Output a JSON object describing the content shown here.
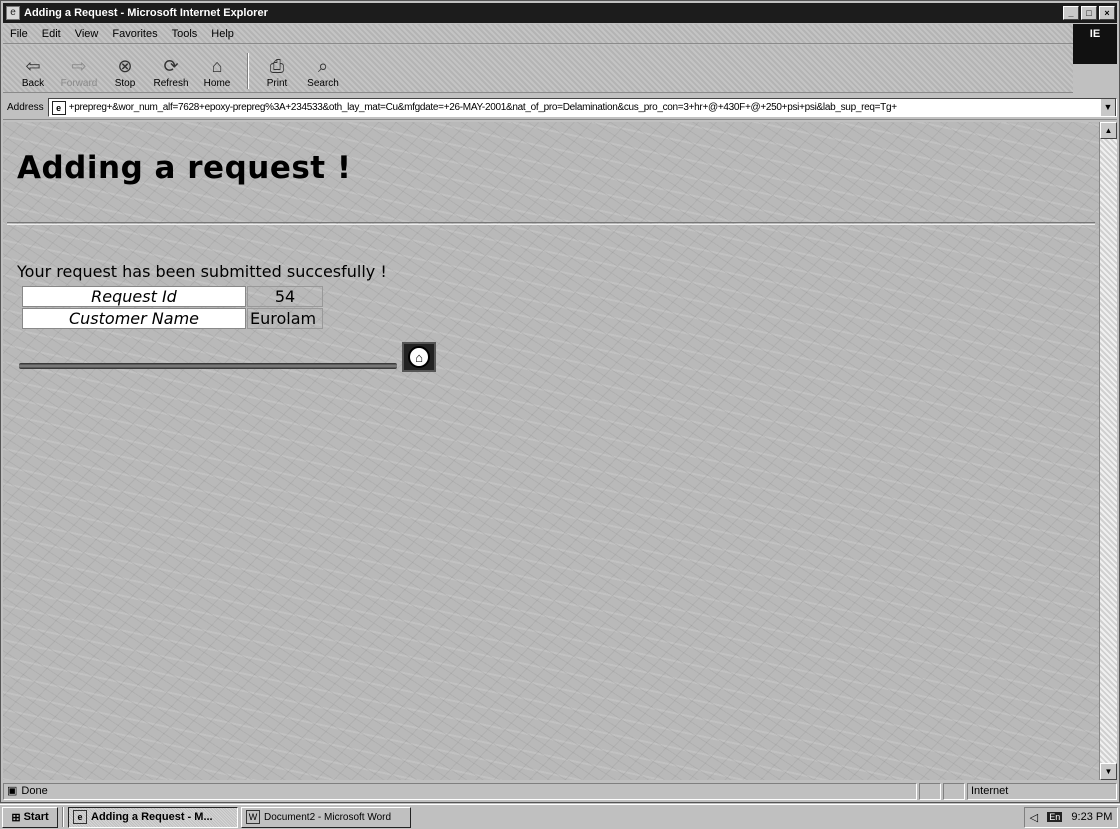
{
  "window": {
    "title": "Adding a Request - Microsoft Internet Explorer",
    "icon": "ie-page-icon",
    "controls": [
      "_",
      "□",
      "×"
    ]
  },
  "menubar": {
    "items": [
      "File",
      "Edit",
      "View",
      "Favorites",
      "Tools",
      "Help"
    ],
    "throbber": "IE"
  },
  "toolbar": {
    "buttons": [
      {
        "label": "Back",
        "icon": "back-arrow-icon",
        "glyph": "⇦",
        "enabled": true
      },
      {
        "label": "Forward",
        "icon": "forward-arrow-icon",
        "glyph": "⇨",
        "enabled": false
      },
      {
        "label": "Stop",
        "icon": "stop-icon",
        "glyph": "⊗",
        "enabled": true
      },
      {
        "label": "Refresh",
        "icon": "refresh-icon",
        "glyph": "⟳",
        "enabled": true
      },
      {
        "label": "Home",
        "icon": "home-icon",
        "glyph": "⌂",
        "enabled": true
      },
      {
        "label": "Print",
        "icon": "print-icon",
        "glyph": "⎙",
        "enabled": true
      },
      {
        "label": "Search",
        "icon": "search-icon",
        "glyph": "⌕",
        "enabled": true
      }
    ]
  },
  "address": {
    "label": "Address",
    "url": "+prepreg+&wor_num_alf=7628+epoxy-prepreg%3A+234533&oth_lay_mat=Cu&mfgdate=+26-MAY-2001&nat_of_pro=Delamination&cus_pro_con=3+hr+@+430F+@+250+psi+psi&lab_sup_req=Tg+"
  },
  "page": {
    "heading": "Adding a request !",
    "success_message": "Your request has been submitted succesfully !",
    "details": [
      {
        "label": "Request Id",
        "value": "54"
      },
      {
        "label": "Customer Name",
        "value": "Eurolam"
      }
    ],
    "home_icon": "home-icon"
  },
  "statusbar": {
    "status": "Done",
    "zone": "Internet"
  },
  "taskbar": {
    "start_label": "Start",
    "tasks": [
      {
        "label": "Adding a Request - M...",
        "active": true,
        "icon": "ie-icon"
      },
      {
        "label": "Document2 - Microsoft Word",
        "active": false,
        "icon": "word-icon"
      }
    ],
    "tray": {
      "language": "En",
      "time": "9:23 PM"
    }
  },
  "colors": {
    "titlebar": "#1c1c1c",
    "chrome": "#c0c0c0",
    "content_bg": "#b9b9b9"
  }
}
